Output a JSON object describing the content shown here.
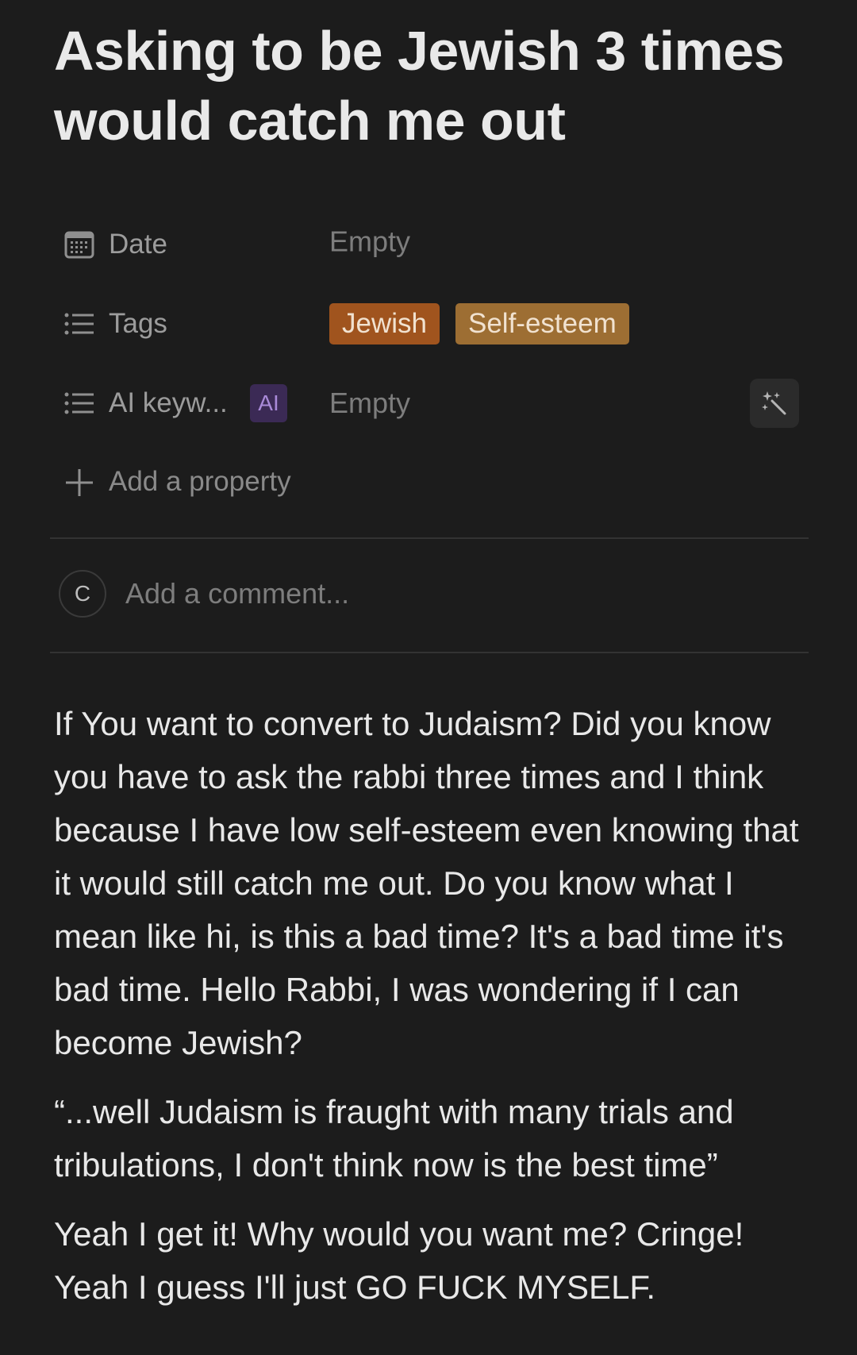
{
  "page": {
    "title": "Asking to be Jewish 3 times would catch me out"
  },
  "properties": [
    {
      "name": "Date",
      "icon": "calendar-icon",
      "value": "Empty"
    },
    {
      "name": "Tags",
      "icon": "list-icon",
      "tags": [
        {
          "label": "Jewish",
          "color": "#a0541e"
        },
        {
          "label": "Self-esteem",
          "color": "#9d6e33"
        }
      ]
    },
    {
      "name": "AI keyw...",
      "icon": "list-icon",
      "badge": "AI",
      "value": "Empty",
      "action_icon": "magic-wand-icon"
    }
  ],
  "add_property_label": "Add a property",
  "comment": {
    "avatar_initial": "C",
    "placeholder": "Add a comment..."
  },
  "body": {
    "paragraphs": [
      "If You want to convert to Judaism? Did you know you have to ask the rabbi three times and I think because I have low self-esteem even knowing that it would still catch me out. Do you know what I mean like hi, is this a bad time? It's a bad time it's bad time. Hello Rabbi, I was wondering if I can become Jewish?",
      "“...well Judaism is fraught with many trials and tribulations, I don't think now is the best time”",
      "Yeah I get it! Why would you want me? Cringe! Yeah I guess I'll just GO FUCK MYSELF."
    ]
  },
  "colors": {
    "background": "#1c1c1c",
    "tag_jewish": "#a0541e",
    "tag_self_esteem": "#9d6e33",
    "ai_badge": "#3b2a55"
  }
}
